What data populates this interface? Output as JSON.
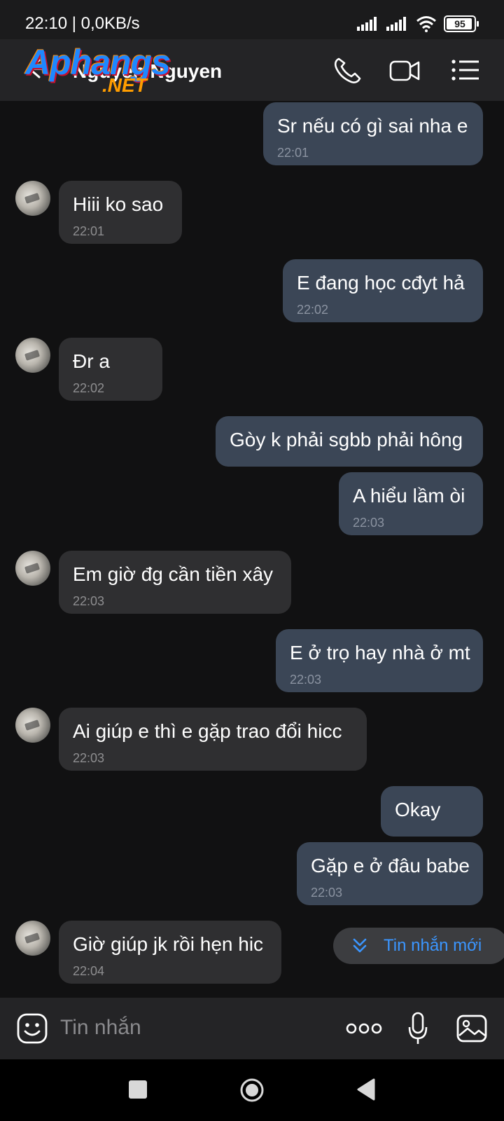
{
  "status_bar": {
    "time_speed": "22:10 | 0,0KB/s",
    "battery": "95",
    "battery_level": 0.95
  },
  "header": {
    "contact_name": "Nguyen Nguyen",
    "watermark_main": "Aphangs",
    "watermark_sub": ".NET"
  },
  "messages": [
    {
      "dir": "out",
      "text": "Sr nếu có gì sai nha e",
      "time": "22:01"
    },
    {
      "dir": "in",
      "text": "Hiii ko sao",
      "time": "22:01"
    },
    {
      "dir": "out",
      "text": "E đang học cđyt hả",
      "time": "22:02"
    },
    {
      "dir": "in",
      "text": "Đr a",
      "time": "22:02"
    },
    {
      "dir": "out",
      "text": "Gòy k phải sgbb phải hông",
      "time": ""
    },
    {
      "dir": "out",
      "text": "A hiểu lầm òi",
      "time": "22:03"
    },
    {
      "dir": "in",
      "text": "Em giờ đg cần tiền xây",
      "time": "22:03"
    },
    {
      "dir": "out",
      "text": "E ở trọ hay nhà ở mt",
      "time": "22:03"
    },
    {
      "dir": "in",
      "text": "Ai giúp e thì e gặp trao đổi hicc",
      "time": "22:03"
    },
    {
      "dir": "out",
      "text": "Okay",
      "time": ""
    },
    {
      "dir": "out",
      "text": "Gặp e ở đâu babe",
      "time": "22:03"
    },
    {
      "dir": "in",
      "text": "Giờ giúp jk rồi hẹn hic",
      "time": "22:04"
    }
  ],
  "new_messages_label": "Tin nhắn mới",
  "input": {
    "placeholder": "Tin nhắn"
  },
  "colors": {
    "outgoing_bubble": "#3b4656",
    "incoming_bubble": "#2f2f31",
    "accent": "#3b96ff"
  }
}
